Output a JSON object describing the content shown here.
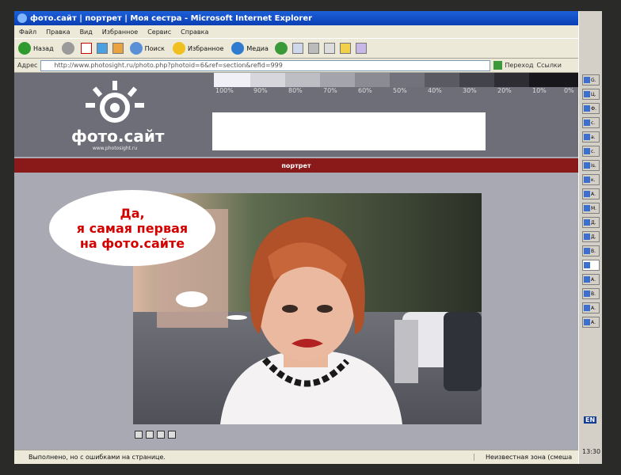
{
  "window": {
    "title": "фото.сайт | портрет | Моя сестра - Microsoft Internet Explorer"
  },
  "menu": [
    "Файл",
    "Правка",
    "Вид",
    "Избранное",
    "Сервис",
    "Справка"
  ],
  "toolbar": {
    "back_label": "Назад",
    "search_label": "Поиск",
    "favorites_label": "Избранное",
    "media_label": "Медиа"
  },
  "address": {
    "label": "Адрес",
    "url": "http://www.photosight.ru/photo.php?photoid=6&ref=section&refid=999",
    "go_label": "Переход",
    "links_label": "Ссылки"
  },
  "site": {
    "logo_text": "фото.сайт",
    "logo_url": "www.photosight.ru",
    "gray_scale_labels": [
      "100%",
      "90%",
      "80%",
      "70%",
      "60%",
      "50%",
      "40%",
      "30%",
      "20%",
      "10%",
      "0%"
    ],
    "section": "портрет",
    "bubble_lines": [
      "Да,",
      "я самая первая",
      "на фото.сайте"
    ]
  },
  "status": {
    "left": "Выполнено, но с ошибками на странице.",
    "right": "Неизвестная зона (смеша"
  },
  "taskbar": {
    "items": [
      "G.",
      "Ц.",
      "Ф.",
      "с.",
      "а.",
      "с.",
      "Is.",
      "к.",
      "А.",
      "М.",
      "Д.",
      "Д.",
      "В.",
      "",
      "А.",
      "В.",
      "А.",
      "А."
    ],
    "lang": "EN",
    "clock": "13:30"
  },
  "colors": {
    "title_bar": "#0b3fb4",
    "section_bar": "#8a1a1a",
    "bubble_text": "#d40000",
    "header_bg": "#6e6e78"
  }
}
